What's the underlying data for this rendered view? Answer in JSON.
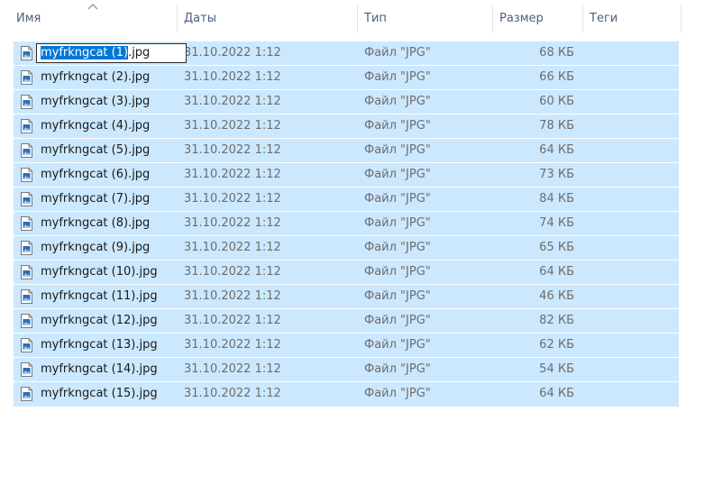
{
  "columns": {
    "name": "Имя",
    "date": "Даты",
    "type": "Тип",
    "size": "Размер",
    "tags": "Теги"
  },
  "rename": {
    "selected_part": "myfrkngcat (1)",
    "rest": ".jpg"
  },
  "files": [
    {
      "name": "myfrkngcat (1).jpg",
      "date": "31.10.2022 1:12",
      "type": "Файл \"JPG\"",
      "size": "68 КБ"
    },
    {
      "name": "myfrkngcat (2).jpg",
      "date": "31.10.2022 1:12",
      "type": "Файл \"JPG\"",
      "size": "66 КБ"
    },
    {
      "name": "myfrkngcat (3).jpg",
      "date": "31.10.2022 1:12",
      "type": "Файл \"JPG\"",
      "size": "60 КБ"
    },
    {
      "name": "myfrkngcat (4).jpg",
      "date": "31.10.2022 1:12",
      "type": "Файл \"JPG\"",
      "size": "78 КБ"
    },
    {
      "name": "myfrkngcat (5).jpg",
      "date": "31.10.2022 1:12",
      "type": "Файл \"JPG\"",
      "size": "64 КБ"
    },
    {
      "name": "myfrkngcat (6).jpg",
      "date": "31.10.2022 1:12",
      "type": "Файл \"JPG\"",
      "size": "73 КБ"
    },
    {
      "name": "myfrkngcat (7).jpg",
      "date": "31.10.2022 1:12",
      "type": "Файл \"JPG\"",
      "size": "84 КБ"
    },
    {
      "name": "myfrkngcat (8).jpg",
      "date": "31.10.2022 1:12",
      "type": "Файл \"JPG\"",
      "size": "74 КБ"
    },
    {
      "name": "myfrkngcat (9).jpg",
      "date": "31.10.2022 1:12",
      "type": "Файл \"JPG\"",
      "size": "65 КБ"
    },
    {
      "name": "myfrkngcat (10).jpg",
      "date": "31.10.2022 1:12",
      "type": "Файл \"JPG\"",
      "size": "64 КБ"
    },
    {
      "name": "myfrkngcat (11).jpg",
      "date": "31.10.2022 1:12",
      "type": "Файл \"JPG\"",
      "size": "46 КБ"
    },
    {
      "name": "myfrkngcat (12).jpg",
      "date": "31.10.2022 1:12",
      "type": "Файл \"JPG\"",
      "size": "82 КБ"
    },
    {
      "name": "myfrkngcat (13).jpg",
      "date": "31.10.2022 1:12",
      "type": "Файл \"JPG\"",
      "size": "62 КБ"
    },
    {
      "name": "myfrkngcat (14).jpg",
      "date": "31.10.2022 1:12",
      "type": "Файл \"JPG\"",
      "size": "54 КБ"
    },
    {
      "name": "myfrkngcat (15).jpg",
      "date": "31.10.2022 1:12",
      "type": "Файл \"JPG\"",
      "size": "64 КБ"
    }
  ],
  "icons": {
    "sort": "chevron-up-icon",
    "file": "image-file-icon"
  },
  "colors": {
    "selection": "#cce8ff",
    "rename_highlight": "#0078d7",
    "header_text": "#4c607a"
  }
}
